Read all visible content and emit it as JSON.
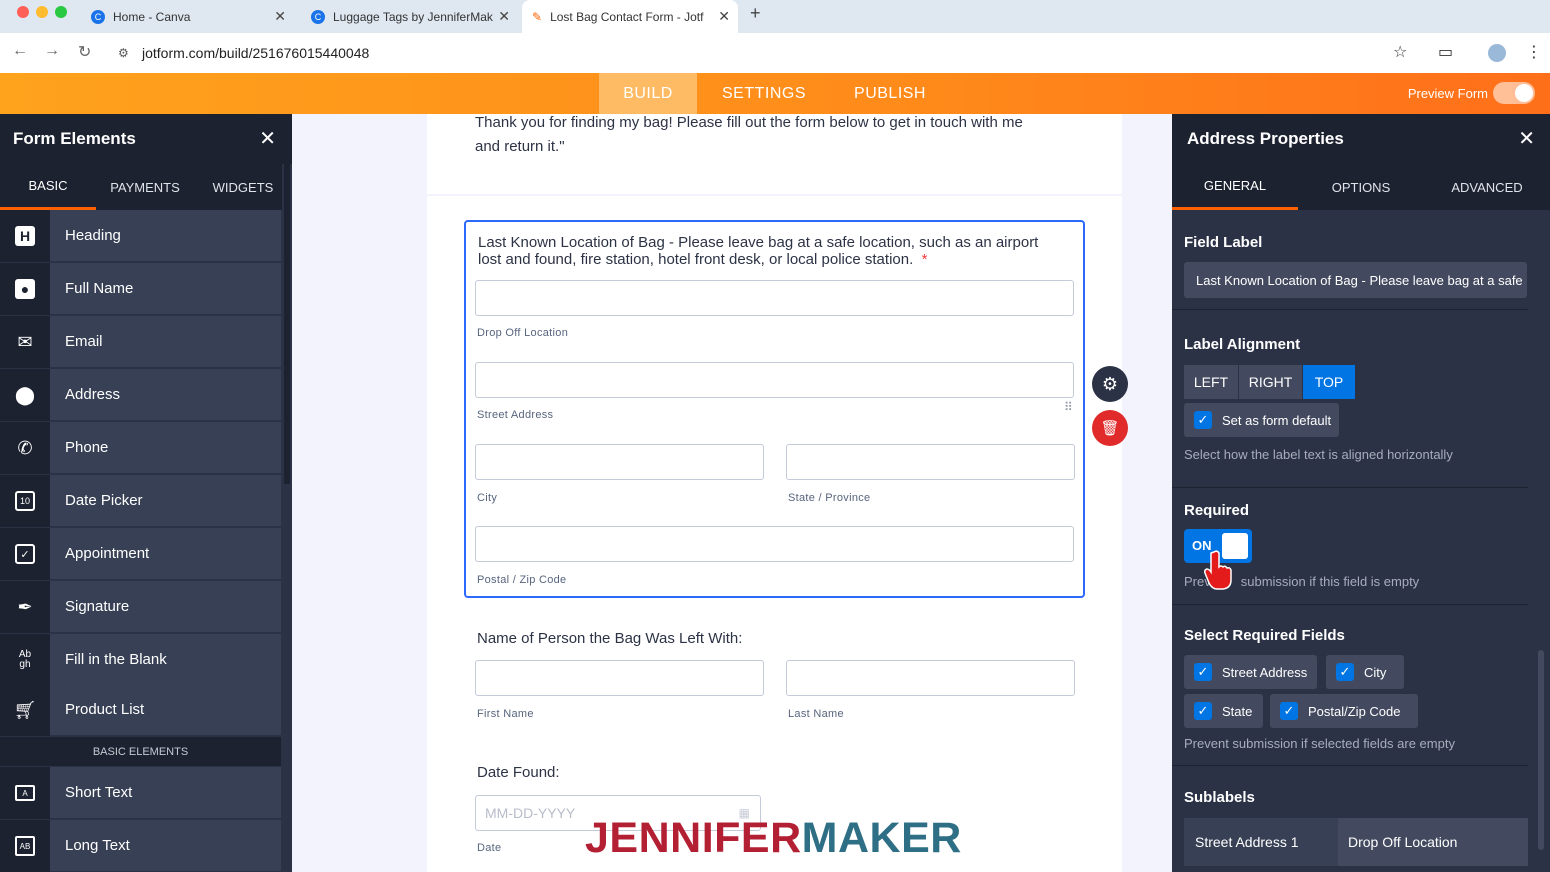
{
  "browser": {
    "tabs": [
      {
        "title": "Home - Canva"
      },
      {
        "title": "Luggage Tags by JenniferMak"
      },
      {
        "title": "Lost Bag Contact Form - Jotf"
      }
    ],
    "url": "jotform.com/build/251676015440048"
  },
  "topnav": {
    "items": [
      "BUILD",
      "SETTINGS",
      "PUBLISH"
    ],
    "active": "BUILD",
    "preview_label": "Preview Form",
    "accent": "#ff8a1a"
  },
  "left_panel": {
    "title": "Form Elements",
    "tabs": [
      "BASIC",
      "PAYMENTS",
      "WIDGETS"
    ],
    "active_tab": "BASIC",
    "items": [
      {
        "label": "Heading",
        "icon": "heading-icon"
      },
      {
        "label": "Full Name",
        "icon": "person-icon"
      },
      {
        "label": "Email",
        "icon": "envelope-icon"
      },
      {
        "label": "Address",
        "icon": "map-pin-icon"
      },
      {
        "label": "Phone",
        "icon": "phone-icon"
      },
      {
        "label": "Date Picker",
        "icon": "calendar-icon"
      },
      {
        "label": "Appointment",
        "icon": "calendar-check-icon"
      },
      {
        "label": "Signature",
        "icon": "pen-icon"
      },
      {
        "label": "Fill in the Blank",
        "icon": "fill-blank-icon"
      },
      {
        "label": "Product List",
        "icon": "cart-icon"
      }
    ],
    "section_label": "BASIC ELEMENTS",
    "items2": [
      {
        "label": "Short Text",
        "icon": "short-text-icon"
      },
      {
        "label": "Long Text",
        "icon": "long-text-icon"
      }
    ]
  },
  "form": {
    "intro_line1": "Thank you for finding my bag! Please fill out the form below to get in touch with me",
    "intro_line2": "and return it.\"",
    "address_field": {
      "label_line1": "Last Known Location of Bag - Please leave bag at a safe location, such as an airport",
      "label_line2": "lost and found, fire station, hotel front desk, or local police station.",
      "required_mark": "*",
      "sublabels": [
        "Drop Off Location",
        "Street Address",
        "City",
        "State / Province",
        "Postal / Zip Code"
      ]
    },
    "name_field": {
      "label": "Name of Person the Bag Was Left With:",
      "sublabels": [
        "First Name",
        "Last Name"
      ]
    },
    "date_field": {
      "label": "Date Found:",
      "placeholder": "MM-DD-YYYY",
      "sublabel": "Date"
    },
    "watermark_part1": "JENNIFER",
    "watermark_part2": "MAKER"
  },
  "right_panel": {
    "title": "Address Properties",
    "tabs": [
      "GENERAL",
      "OPTIONS",
      "ADVANCED"
    ],
    "active_tab": "GENERAL",
    "field_label_title": "Field Label",
    "field_label_value": "Last Known Location of Bag - Please leave bag at a safe",
    "label_alignment_title": "Label Alignment",
    "alignment_options": [
      "LEFT",
      "RIGHT",
      "TOP"
    ],
    "alignment_selected": "TOP",
    "set_default_label": "Set as form default",
    "alignment_desc": "Select how the label text is aligned horizontally",
    "required_title": "Required",
    "required_toggle": "ON",
    "required_desc_a": "Prev",
    "required_desc_b": "submission if this field is empty",
    "select_required_title": "Select Required Fields",
    "required_fields": [
      "Street Address",
      "City",
      "State",
      "Postal/Zip Code"
    ],
    "required_fields_desc": "Prevent submission if selected fields are empty",
    "sublabels_title": "Sublabels",
    "sublabel_row": {
      "key": "Street Address 1",
      "value": "Drop Off Location"
    },
    "accent": "#0075e3"
  }
}
